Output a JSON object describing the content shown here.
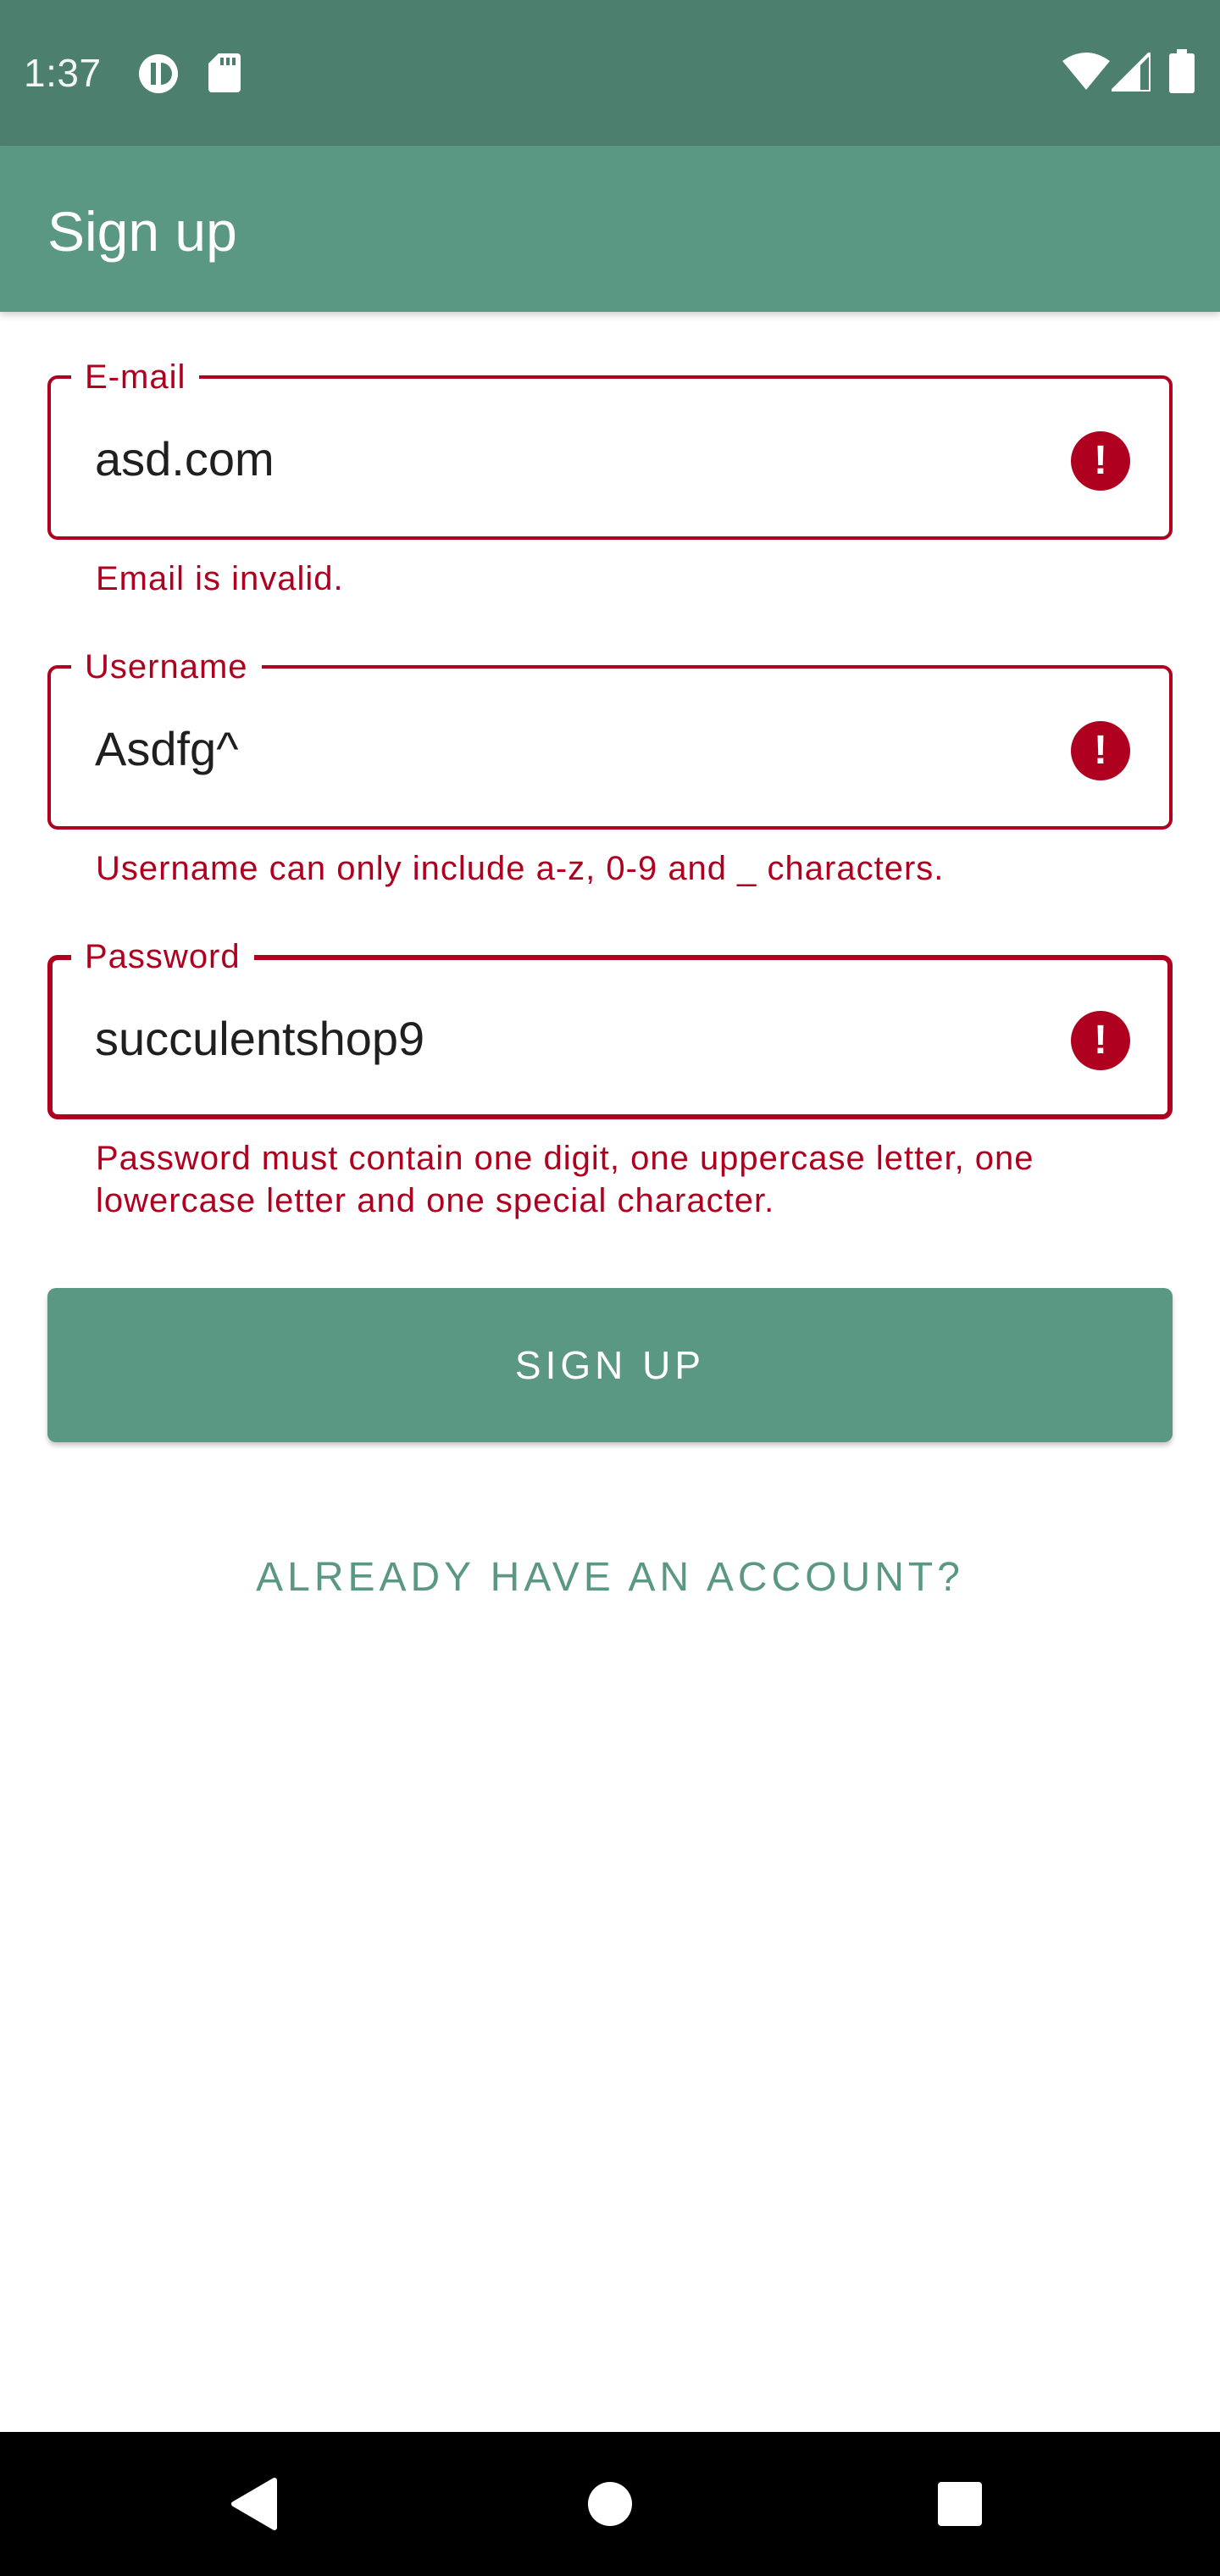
{
  "status_bar": {
    "time": "1:37",
    "icons": [
      "data-saver-icon",
      "sd-card-icon",
      "wifi-icon",
      "cell-signal-icon",
      "battery-icon"
    ]
  },
  "app_bar": {
    "title": "Sign up"
  },
  "form": {
    "email": {
      "label": "E-mail",
      "value": "asd.com",
      "error": "Email is invalid.",
      "error_icon": "!"
    },
    "username": {
      "label": "Username",
      "value": "Asdfg^",
      "error": "Username can only include a-z, 0-9 and _ characters.",
      "error_icon": "!"
    },
    "password": {
      "label": "Password",
      "value": "succulentshop9",
      "error": "Password must contain one digit, one uppercase letter, one lowercase letter and one special character.",
      "error_icon": "!"
    }
  },
  "actions": {
    "signup_label": "SIGN UP",
    "login_link_label": "ALREADY HAVE AN ACCOUNT?"
  },
  "colors": {
    "status_bar": "#4d7f6e",
    "primary": "#5a9883",
    "error": "#b00020"
  },
  "nav_bar": {
    "icons": [
      "back-icon",
      "home-icon",
      "recents-icon"
    ]
  }
}
